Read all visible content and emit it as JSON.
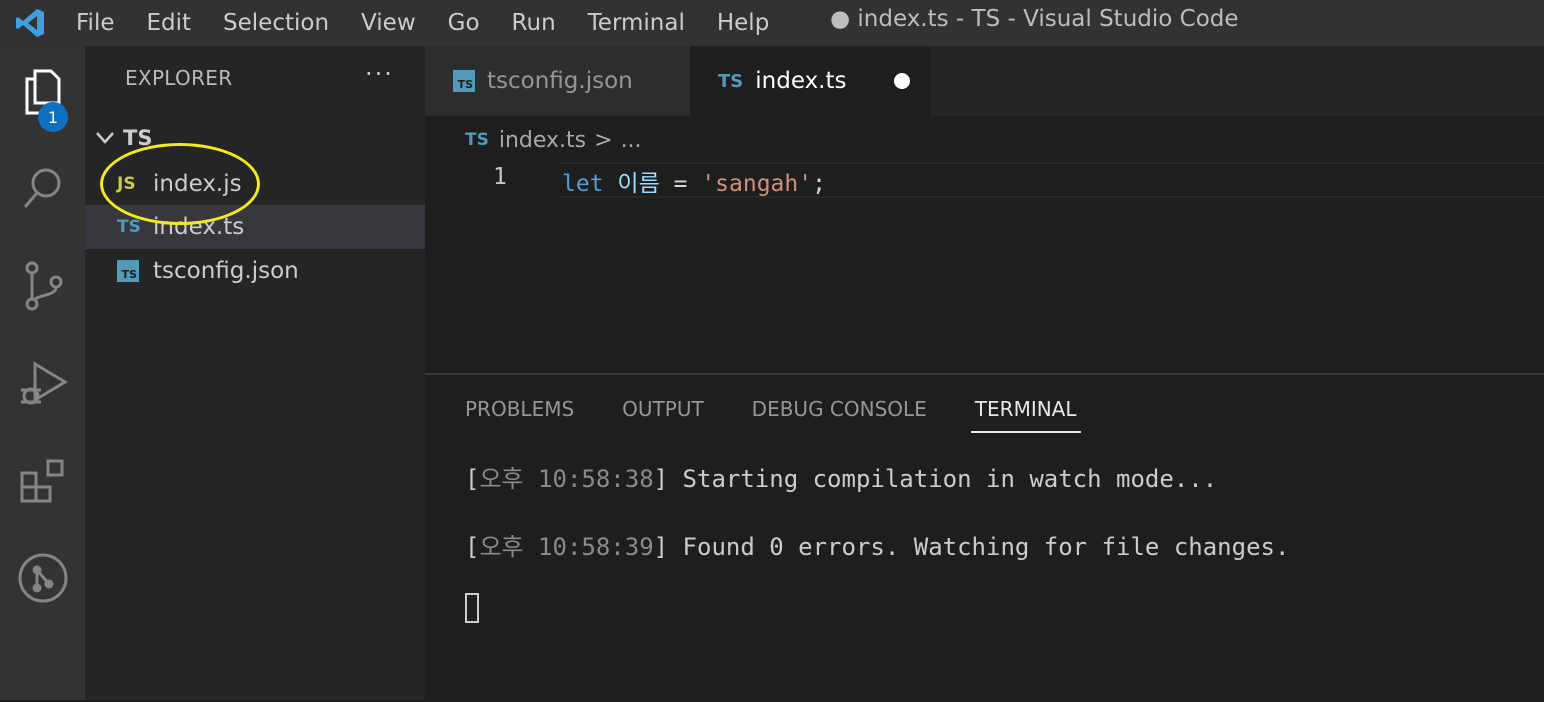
{
  "titlebar": {
    "menu": [
      "File",
      "Edit",
      "Selection",
      "View",
      "Go",
      "Run",
      "Terminal",
      "Help"
    ],
    "window_title": "● index.ts - TS - Visual Studio Code"
  },
  "activitybar": {
    "explorer_badge": "1"
  },
  "sidebar": {
    "header": "EXPLORER",
    "more": "···",
    "folder": "TS",
    "files": [
      {
        "icon": "JS",
        "label": "index.js"
      },
      {
        "icon": "TS",
        "label": "index.ts"
      },
      {
        "icon": "TS",
        "label": "tsconfig.json"
      }
    ]
  },
  "editor": {
    "tabs": [
      {
        "icon": "TS",
        "label": "tsconfig.json"
      },
      {
        "icon": "TS",
        "label": "index.ts"
      }
    ],
    "breadcrumb": {
      "icon": "TS",
      "file": "index.ts",
      "sep": ">",
      "more": "..."
    },
    "line_number": "1",
    "code": {
      "keyword": "let",
      "variable": "이름",
      "operator": "=",
      "string": "'sangah'",
      "semicolon": ";"
    }
  },
  "panel": {
    "tabs": [
      "PROBLEMS",
      "OUTPUT",
      "DEBUG CONSOLE",
      "TERMINAL"
    ],
    "lines": [
      {
        "prefix": "[",
        "time": "오후 10:58:38",
        "suffix": "] Starting compilation in watch mode..."
      },
      {
        "prefix": "[",
        "time": "오후 10:58:39",
        "suffix": "] Found 0 errors. Watching for file changes."
      }
    ]
  },
  "colors": {
    "accent": "#0e70c0",
    "highlight": "#f2ea1d",
    "ts": "#519aba",
    "js": "#cbcb41"
  }
}
